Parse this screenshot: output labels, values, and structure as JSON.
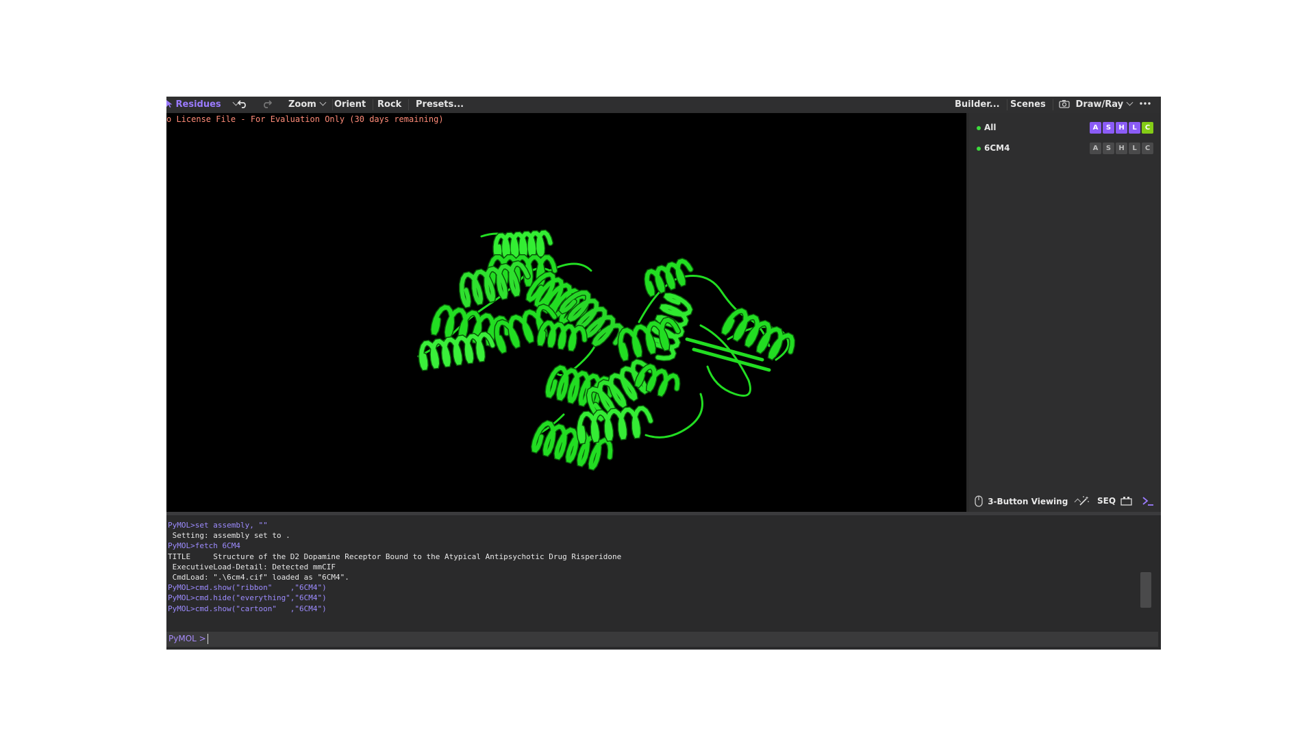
{
  "toolbar": {
    "mode_label": "Residues",
    "zoom": "Zoom",
    "orient": "Orient",
    "rock": "Rock",
    "presets": "Presets...",
    "builder": "Builder...",
    "scenes": "Scenes",
    "drawray": "Draw/Ray",
    "more_icon": "more-horizontal-icon"
  },
  "viewer": {
    "license_text": "o License File - For Evaluation Only (30 days remaining)",
    "ribbon_color": "#22dd22",
    "background": "#000000"
  },
  "objects": [
    {
      "name": "All",
      "buttons": [
        "A",
        "S",
        "H",
        "L",
        "C"
      ],
      "colored": true
    },
    {
      "name": "6CM4",
      "buttons": [
        "A",
        "S",
        "H",
        "L",
        "C"
      ],
      "colored": false
    }
  ],
  "object_button_colors": [
    "#8b5cf6",
    "#8b5cf6",
    "#8b5cf6",
    "#8b5cf6",
    "#84cc16"
  ],
  "panel_bar": {
    "mouse_mode": "3-Button Viewing",
    "seq": "SEQ"
  },
  "console": {
    "lines": [
      {
        "text": "PyMOL>set assembly, \"\"",
        "cmd": true
      },
      {
        "text": " Setting: assembly set to .",
        "cmd": false
      },
      {
        "text": "PyMOL>fetch 6CM4",
        "cmd": true
      },
      {
        "text": "TITLE     Structure of the D2 Dopamine Receptor Bound to the Atypical Antipsychotic Drug Risperidone",
        "cmd": false
      },
      {
        "text": " ExecutiveLoad-Detail: Detected mmCIF",
        "cmd": false
      },
      {
        "text": " CmdLoad: \".\\6cm4.cif\" loaded as \"6CM4\".",
        "cmd": false
      },
      {
        "text": "PyMOL>cmd.show(\"ribbon\"    ,\"6CM4\")",
        "cmd": true
      },
      {
        "text": "PyMOL>cmd.hide(\"everything\",\"6CM4\")",
        "cmd": true
      },
      {
        "text": "PyMOL>cmd.show(\"cartoon\"   ,\"6CM4\")",
        "cmd": true
      }
    ],
    "prompt": "PyMOL >",
    "input_value": ""
  }
}
